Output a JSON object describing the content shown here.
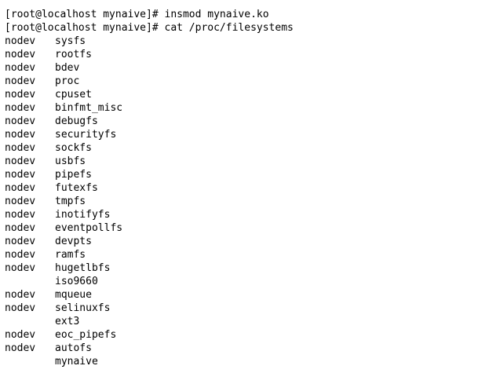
{
  "terminal": {
    "commands": [
      "[root@localhost mynaive]# insmod mynaive.ko",
      "[root@localhost mynaive]# cat /proc/filesystems"
    ],
    "filesystems": [
      {
        "dev": "nodev",
        "name": "sysfs"
      },
      {
        "dev": "nodev",
        "name": "rootfs"
      },
      {
        "dev": "nodev",
        "name": "bdev"
      },
      {
        "dev": "nodev",
        "name": "proc"
      },
      {
        "dev": "nodev",
        "name": "cpuset"
      },
      {
        "dev": "nodev",
        "name": "binfmt_misc"
      },
      {
        "dev": "nodev",
        "name": "debugfs"
      },
      {
        "dev": "nodev",
        "name": "securityfs"
      },
      {
        "dev": "nodev",
        "name": "sockfs"
      },
      {
        "dev": "nodev",
        "name": "usbfs"
      },
      {
        "dev": "nodev",
        "name": "pipefs"
      },
      {
        "dev": "nodev",
        "name": "futexfs"
      },
      {
        "dev": "nodev",
        "name": "tmpfs"
      },
      {
        "dev": "nodev",
        "name": "inotifyfs"
      },
      {
        "dev": "nodev",
        "name": "eventpollfs"
      },
      {
        "dev": "nodev",
        "name": "devpts"
      },
      {
        "dev": "nodev",
        "name": "ramfs"
      },
      {
        "dev": "nodev",
        "name": "hugetlbfs"
      },
      {
        "dev": "",
        "name": "iso9660"
      },
      {
        "dev": "nodev",
        "name": "mqueue"
      },
      {
        "dev": "nodev",
        "name": "selinuxfs"
      },
      {
        "dev": "",
        "name": "ext3"
      },
      {
        "dev": "nodev",
        "name": "eoc_pipefs"
      },
      {
        "dev": "nodev",
        "name": "autofs"
      },
      {
        "dev": "",
        "name": "mynaive"
      }
    ]
  }
}
